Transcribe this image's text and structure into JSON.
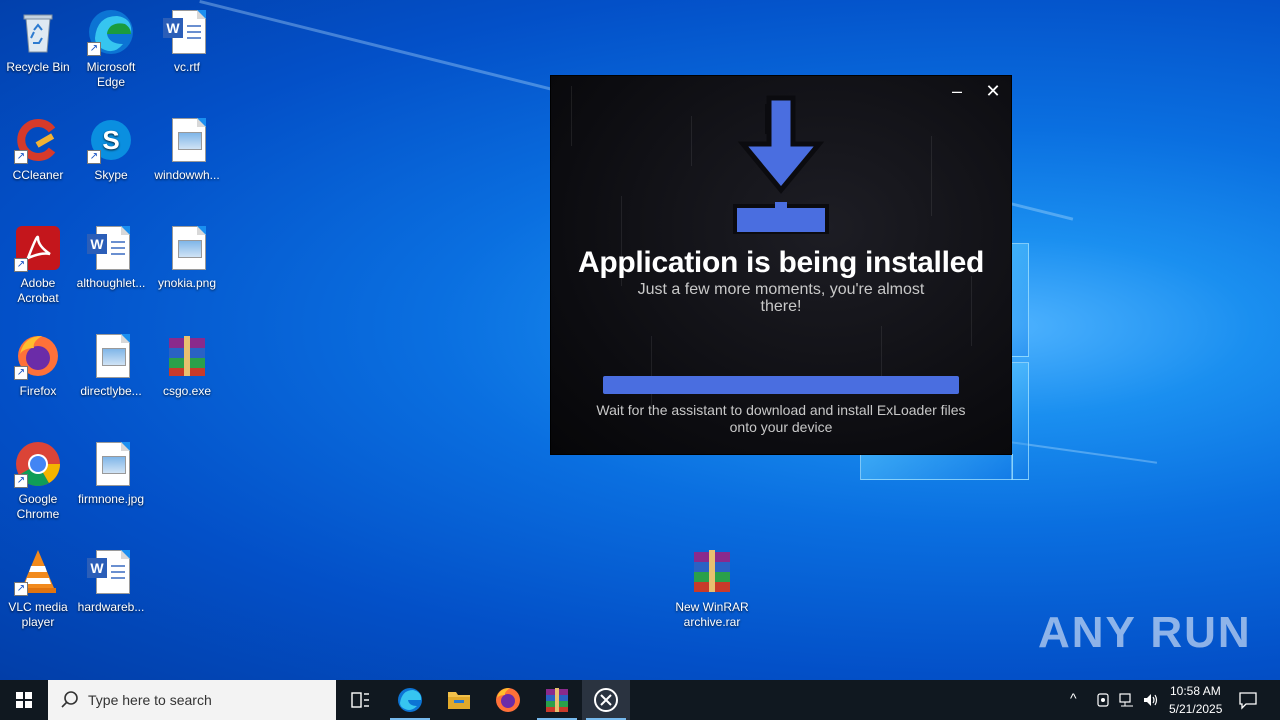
{
  "desktop": {
    "icons": [
      {
        "label": "Recycle Bin",
        "icon": "recycle-bin-icon"
      },
      {
        "label": "Microsoft Edge",
        "icon": "edge-icon"
      },
      {
        "label": "vc.rtf",
        "icon": "word-doc-icon"
      },
      {
        "label": "CCleaner",
        "icon": "ccleaner-icon"
      },
      {
        "label": "Skype",
        "icon": "skype-icon"
      },
      {
        "label": "windowwh...",
        "icon": "image-file-icon"
      },
      {
        "label": "Adobe Acrobat",
        "icon": "acrobat-icon"
      },
      {
        "label": "althoughlet...",
        "icon": "word-doc-icon"
      },
      {
        "label": "ynokia.png",
        "icon": "image-file-icon"
      },
      {
        "label": "Firefox",
        "icon": "firefox-icon"
      },
      {
        "label": "directlybe...",
        "icon": "image-file-icon"
      },
      {
        "label": "csgo.exe",
        "icon": "winrar-icon"
      },
      {
        "label": "Google Chrome",
        "icon": "chrome-icon"
      },
      {
        "label": "firmnone.jpg",
        "icon": "image-file-icon"
      },
      {
        "label": "VLC media player",
        "icon": "vlc-icon"
      },
      {
        "label": "hardwareb...",
        "icon": "word-doc-icon"
      },
      {
        "label": "New WinRAR archive.rar",
        "icon": "winrar-icon"
      }
    ]
  },
  "installer": {
    "title": "Application is being installed",
    "subtitle": "Just a few more moments, you're almost there!",
    "hint": "Wait for the assistant to download and install ExLoader files onto your device",
    "minimize_label": "–",
    "close_label": "✕",
    "progress": 1.0,
    "accent": "#4a6ee0"
  },
  "watermark": {
    "text": "ANY RUN"
  },
  "taskbar": {
    "search_placeholder": "Type here to search",
    "apps": [
      "task-view-icon",
      "edge-icon",
      "file-explorer-icon",
      "firefox-icon",
      "winrar-icon",
      "exloader-icon"
    ],
    "time": "10:58 AM",
    "date": "5/21/2025"
  }
}
